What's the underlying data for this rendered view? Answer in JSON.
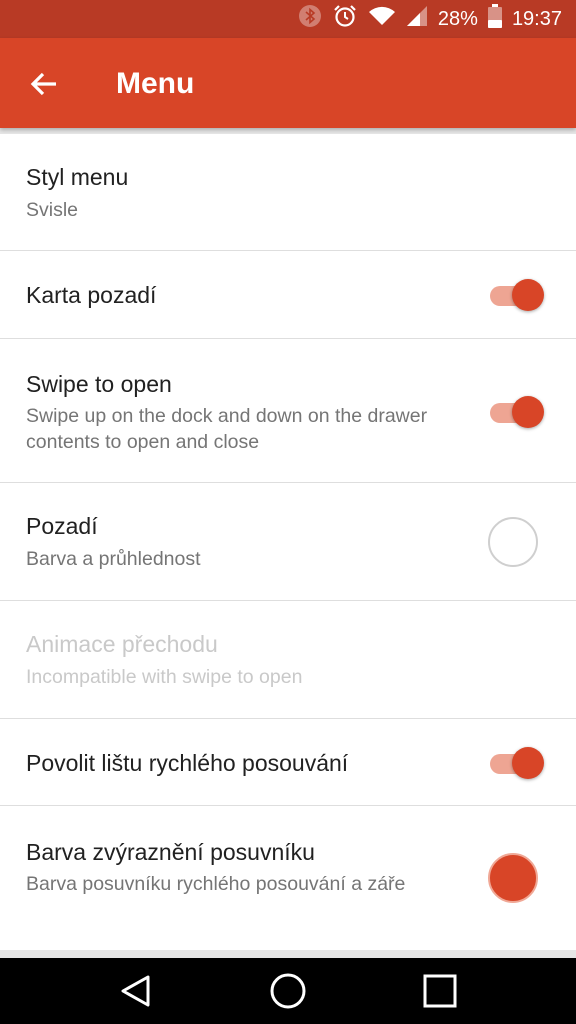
{
  "status_bar": {
    "battery_percent": "28%",
    "time": "19:37",
    "icons": [
      "bluetooth-icon",
      "alarm-icon",
      "wifi-icon",
      "signal-icon",
      "battery-icon"
    ]
  },
  "app_bar": {
    "title": "Menu",
    "back_icon": "arrow-left-icon"
  },
  "settings": {
    "style": {
      "title": "Styl menu",
      "summary": "Svisle"
    },
    "card_bg": {
      "title": "Karta pozadí",
      "enabled": true
    },
    "swipe": {
      "title": "Swipe to open",
      "summary": "Swipe up on the dock and down on the drawer contents to open and close",
      "enabled": true
    },
    "background": {
      "title": "Pozadí",
      "summary": "Barva a průhlednost",
      "color": "#ffffff"
    },
    "animation": {
      "title": "Animace přechodu",
      "summary": "Incompatible with swipe to open",
      "disabled": true
    },
    "fast_scroll": {
      "title": "Povolit lištu rychlého posouvání",
      "enabled": true
    },
    "scroll_color": {
      "title": "Barva zvýraznění posuvníku",
      "summary": "Barva posuvníku rychlého posouvání a záře",
      "color": "#d84527"
    }
  },
  "colors": {
    "accent": "#d84527",
    "status_bar": "#b83a25"
  },
  "nav_bar": {
    "icons": [
      "back-triangle-icon",
      "home-circle-icon",
      "recents-square-icon"
    ]
  }
}
